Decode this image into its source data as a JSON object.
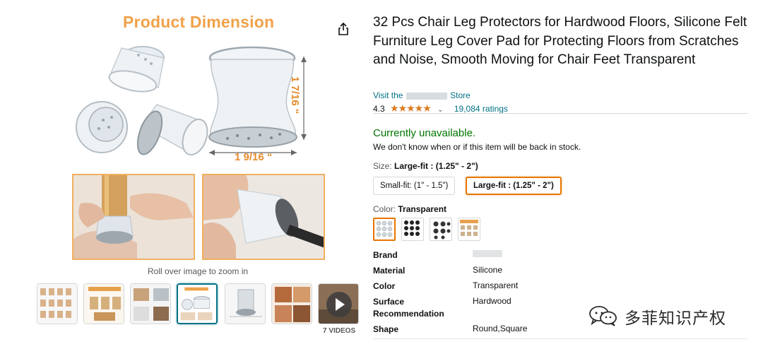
{
  "gallery": {
    "main_image": {
      "heading": "Product Dimension",
      "width_label": "1 9/16 “",
      "height_label": "1 7/16 “"
    },
    "zoom_hint": "Roll over image to zoom in",
    "video_count": "7 VIDEOS",
    "thumbnails": [
      {
        "name": "thumb-1",
        "active": false
      },
      {
        "name": "thumb-2",
        "active": false
      },
      {
        "name": "thumb-3",
        "active": false
      },
      {
        "name": "thumb-4",
        "active": true
      },
      {
        "name": "thumb-5",
        "active": false
      },
      {
        "name": "thumb-6",
        "active": false
      }
    ]
  },
  "product": {
    "title": "32 Pcs Chair Leg Protectors for Hardwood Floors, Silicone Felt Furniture Leg Cover Pad for Protecting Floors from Scratches and Noise, Smooth Moving for Chair Feet Transparent",
    "store_prefix": "Visit the",
    "store_suffix": "Store",
    "rating_value": "4.3",
    "rating_stars": "★★★★★",
    "ratings_count": "19,084 ratings",
    "availability": "Currently unavailable.",
    "availability_note": "We don't know when or if this item will be back in stock.",
    "size": {
      "label": "Size:",
      "selected": "Large-fit : (1.25\" - 2\")",
      "options": [
        "Small-fit: (1\" - 1.5\")",
        "Large-fit : (1.25\" - 2\")"
      ]
    },
    "color": {
      "label": "Color:",
      "selected": "Transparent",
      "swatches": [
        "swatch-transparent",
        "swatch-black-a",
        "swatch-black-b",
        "swatch-mixed"
      ]
    },
    "specs": [
      {
        "key": "Brand",
        "value": ""
      },
      {
        "key": "Material",
        "value": "Silicone"
      },
      {
        "key": "Color",
        "value": "Transparent"
      },
      {
        "key": "Surface Recommendation",
        "value": "Hardwood"
      },
      {
        "key": "Shape",
        "value": "Round,Square"
      }
    ]
  },
  "watermark": {
    "text": "多菲知识产权"
  },
  "colors": {
    "link": "#007185",
    "available_green": "#007600",
    "star_orange": "#de7921",
    "selected_border": "#e77600",
    "dimension_orange": "#f0a24a"
  }
}
